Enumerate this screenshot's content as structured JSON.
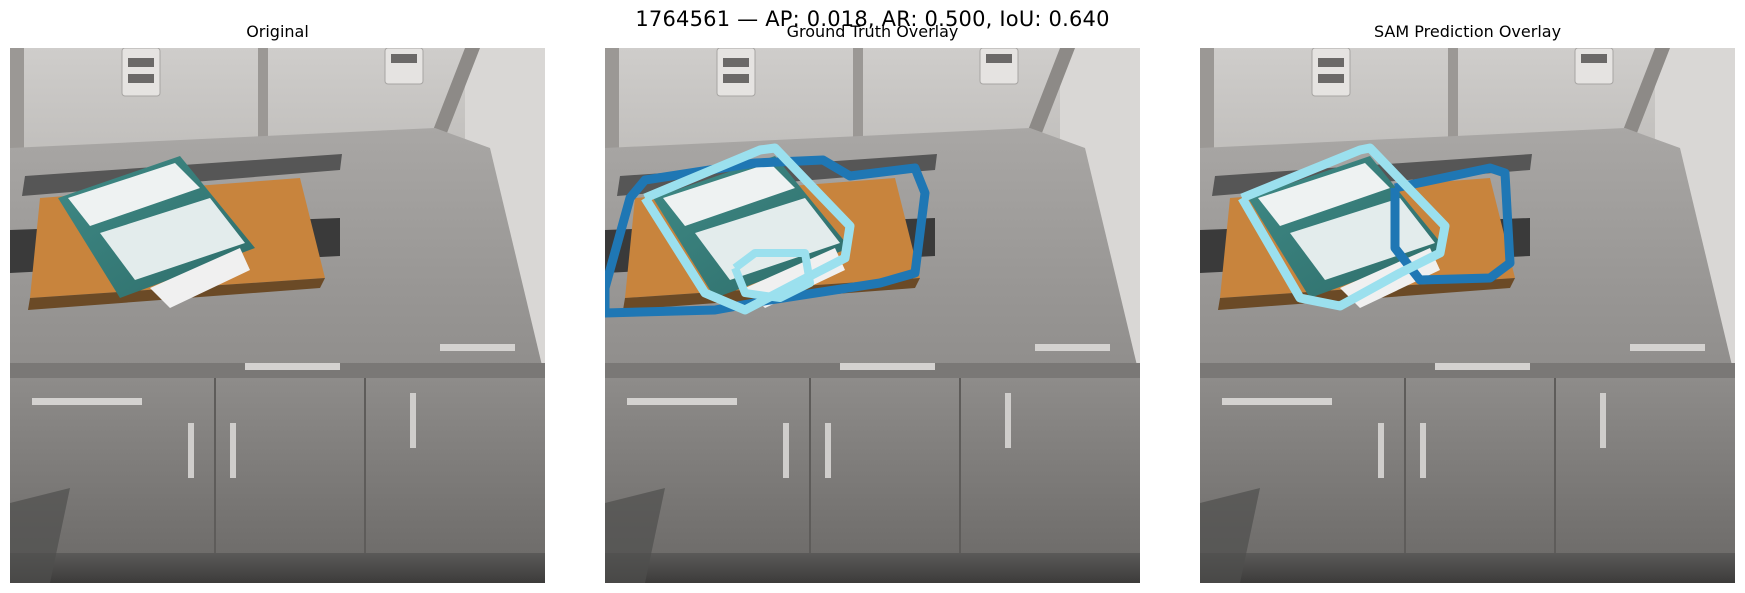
{
  "figure": {
    "suptitle": "1764561 — AP: 0.018, AR: 0.500, IoU: 0.640"
  },
  "panels": [
    {
      "title": "Original"
    },
    {
      "title": "Ground Truth Overlay"
    },
    {
      "title": "SAM Prediction Overlay"
    }
  ],
  "colors": {
    "gt_outline_dark": "#1f77b4",
    "gt_outline_light": "#9be0ee",
    "pred_outline_dark": "#1f77b4",
    "pred_outline_light": "#9be0ee"
  }
}
